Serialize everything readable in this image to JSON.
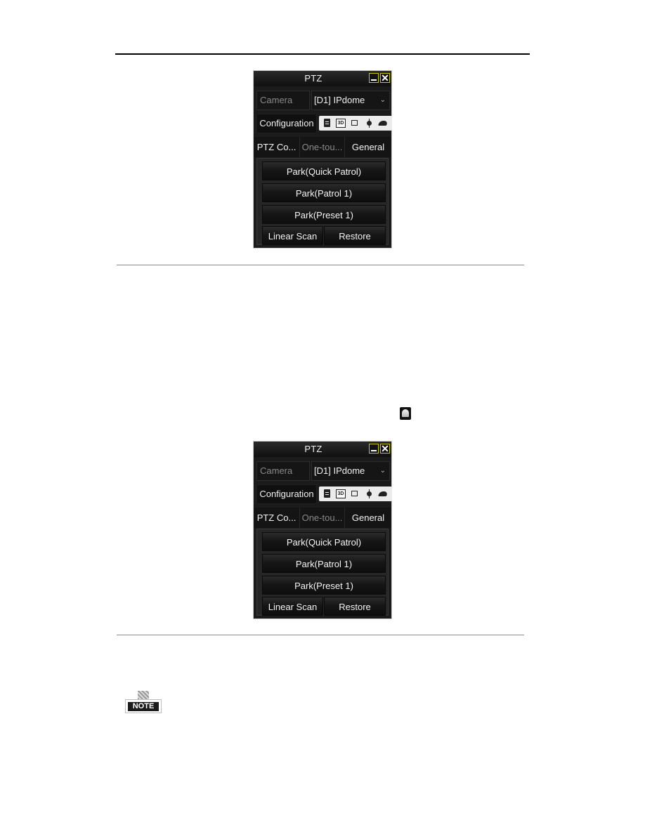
{
  "document": {
    "figures": [
      {
        "window_title": "PTZ",
        "camera_label": "Camera",
        "camera_value": "[D1] IPdome",
        "configuration_label": "Configuration",
        "toolbar_icons": [
          "menu-icon",
          "3d-icon",
          "frame-icon",
          "light-icon",
          "wiper-icon"
        ],
        "toolbar_3d_text": "3D",
        "tabs": [
          "PTZ Co...",
          "One-tou...",
          "General"
        ],
        "active_tab": "General",
        "buttons": [
          "Park(Quick Patrol)",
          "Park(Patrol 1)",
          "Park(Preset 1)",
          "Linear Scan",
          "Restore"
        ]
      },
      {
        "window_title": "PTZ",
        "camera_label": "Camera",
        "camera_value": "[D1] IPdome",
        "configuration_label": "Configuration",
        "toolbar_icons": [
          "menu-icon",
          "3d-icon",
          "frame-icon",
          "light-icon",
          "wiper-icon"
        ],
        "toolbar_3d_text": "3D",
        "tabs": [
          "PTZ Co...",
          "One-tou...",
          "General"
        ],
        "active_tab": "General",
        "buttons": [
          "Park(Quick Patrol)",
          "Park(Patrol 1)",
          "Park(Preset 1)",
          "Linear Scan",
          "Restore"
        ]
      }
    ],
    "note_label": "NOTE",
    "colors": {
      "window_bg": "#1b1b1b",
      "title_button_border": "#c8c400",
      "text_active": "#f5f5f5",
      "text_muted": "#8a8a8a",
      "toolbar_bg": "#ececec"
    }
  }
}
